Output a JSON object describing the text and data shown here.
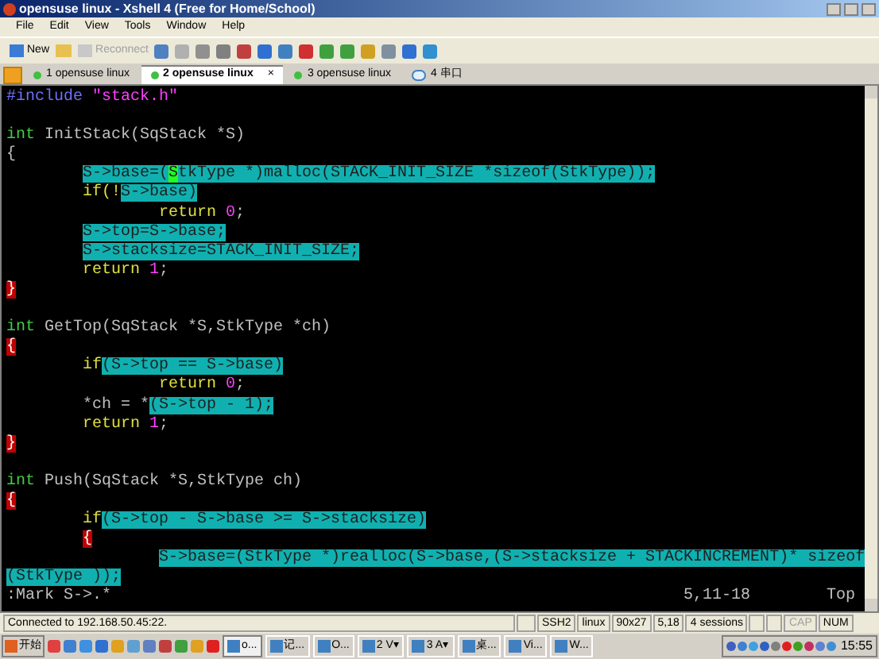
{
  "window": {
    "title": "opensuse linux - Xshell 4 (Free for Home/School)"
  },
  "menu": [
    "File",
    "Edit",
    "View",
    "Tools",
    "Window",
    "Help"
  ],
  "toolbar": [
    {
      "label": "New",
      "disabled": false
    },
    {
      "label": "Reconnect",
      "disabled": true
    }
  ],
  "tabs": [
    {
      "label": "1 opensuse linux",
      "selected": false,
      "kind": "session"
    },
    {
      "label": "2 opensuse linux",
      "selected": true,
      "kind": "session",
      "close": "×"
    },
    {
      "label": "3 opensuse linux",
      "selected": false,
      "kind": "session"
    },
    {
      "label": "4 串口",
      "selected": false,
      "kind": "serial"
    }
  ],
  "terminal": {
    "lines": [
      {
        "kind": "code",
        "segments": [
          {
            "text": "#include ",
            "kind": "preproc"
          },
          {
            "text": "\"stack.h\"",
            "kind": "string"
          }
        ]
      },
      {
        "kind": "blank"
      },
      {
        "kind": "code",
        "segments": [
          {
            "text": "int",
            "kind": "type"
          },
          {
            "text": " InitStack(SqStack *S)",
            "kind": "plain"
          }
        ]
      },
      {
        "kind": "code",
        "segments": [
          {
            "text": "{",
            "kind": "plain"
          }
        ]
      },
      {
        "kind": "code",
        "segments": [
          {
            "kind": "tab"
          },
          {
            "text": "S->base=(",
            "kind": "highlight"
          },
          {
            "text": "S",
            "kind": "cursor"
          },
          {
            "text": "tkType *)malloc(STACK_INIT_SIZE *sizeof(StkType));",
            "kind": "highlight"
          }
        ]
      },
      {
        "kind": "code",
        "segments": [
          {
            "kind": "tab"
          },
          {
            "text": "if(!",
            "kind": "keyword"
          },
          {
            "text": "S->base)",
            "kind": "highlight"
          }
        ]
      },
      {
        "kind": "code",
        "segments": [
          {
            "kind": "tab"
          },
          {
            "kind": "tab"
          },
          {
            "text": "return",
            "kind": "keyword"
          },
          {
            "text": " 0",
            "kind": "number"
          },
          {
            "text": ";",
            "kind": "plain"
          }
        ]
      },
      {
        "kind": "code",
        "segments": [
          {
            "kind": "tab"
          },
          {
            "text": "S->top=S->base;",
            "kind": "highlight"
          }
        ]
      },
      {
        "kind": "code",
        "segments": [
          {
            "kind": "tab"
          },
          {
            "text": "S->stacksize=STACK_INIT_SIZE;",
            "kind": "highlight"
          }
        ]
      },
      {
        "kind": "code",
        "segments": [
          {
            "kind": "tab"
          },
          {
            "text": "return",
            "kind": "keyword"
          },
          {
            "text": " 1",
            "kind": "number"
          },
          {
            "text": ";",
            "kind": "plain"
          }
        ]
      },
      {
        "kind": "code",
        "segments": [
          {
            "text": "}",
            "kind": "bracket"
          }
        ]
      },
      {
        "kind": "blank"
      },
      {
        "kind": "code",
        "segments": [
          {
            "text": "int",
            "kind": "type"
          },
          {
            "text": " GetTop(SqStack *S,StkType *ch)",
            "kind": "plain"
          }
        ]
      },
      {
        "kind": "code",
        "segments": [
          {
            "text": "{",
            "kind": "bracket"
          }
        ]
      },
      {
        "kind": "code",
        "segments": [
          {
            "kind": "tab"
          },
          {
            "text": "if",
            "kind": "keyword"
          },
          {
            "text": "(S->top == S->base)",
            "kind": "highlight"
          }
        ]
      },
      {
        "kind": "code",
        "segments": [
          {
            "kind": "tab"
          },
          {
            "kind": "tab"
          },
          {
            "text": "return",
            "kind": "keyword"
          },
          {
            "text": " 0",
            "kind": "number"
          },
          {
            "text": ";",
            "kind": "plain"
          }
        ]
      },
      {
        "kind": "code",
        "segments": [
          {
            "kind": "tab"
          },
          {
            "text": "*ch = *",
            "kind": "plain"
          },
          {
            "text": "(S->top - 1);",
            "kind": "highlight"
          }
        ]
      },
      {
        "kind": "code",
        "segments": [
          {
            "kind": "tab"
          },
          {
            "text": "return",
            "kind": "keyword"
          },
          {
            "text": " 1",
            "kind": "number"
          },
          {
            "text": ";",
            "kind": "plain"
          }
        ]
      },
      {
        "kind": "code",
        "segments": [
          {
            "text": "}",
            "kind": "bracket"
          }
        ]
      },
      {
        "kind": "blank"
      },
      {
        "kind": "code",
        "segments": [
          {
            "text": "int",
            "kind": "type"
          },
          {
            "text": " Push(SqStack *S,StkType ch)",
            "kind": "plain"
          }
        ]
      },
      {
        "kind": "code",
        "segments": [
          {
            "text": "{",
            "kind": "bracket"
          }
        ]
      },
      {
        "kind": "code",
        "segments": [
          {
            "kind": "tab"
          },
          {
            "text": "if",
            "kind": "keyword"
          },
          {
            "text": "(S->top - S->base >= S->stacksize)",
            "kind": "highlight"
          }
        ]
      },
      {
        "kind": "code",
        "segments": [
          {
            "kind": "tab"
          },
          {
            "text": "{",
            "kind": "bracket"
          }
        ]
      },
      {
        "kind": "code",
        "segments": [
          {
            "kind": "tab"
          },
          {
            "kind": "tab"
          },
          {
            "text": "S->base=(StkType *)realloc(S->base,(S->stacksize + STACKINCREMENT)* sizeof",
            "kind": "highlight"
          }
        ]
      },
      {
        "kind": "code",
        "segments": [
          {
            "text": "(StkType ));",
            "kind": "highlight"
          }
        ]
      }
    ],
    "command": ":Mark S->.*",
    "position": "5,11-18",
    "scroll": "Top"
  },
  "status_bar": {
    "message": "Connected to 192.168.50.45:22.",
    "fields": [
      {
        "text": "SSH2",
        "disabled": false
      },
      {
        "text": "linux",
        "disabled": false
      },
      {
        "text": "90x27",
        "disabled": false
      },
      {
        "text": "5,18",
        "disabled": false
      },
      {
        "text": "4 sessions",
        "disabled": false
      },
      {
        "text": "CAP",
        "disabled": true
      },
      {
        "text": "NUM",
        "disabled": false
      }
    ]
  },
  "taskbar": {
    "start": "开始",
    "items": [
      {
        "label": "o...",
        "selected": true
      },
      {
        "label": "记...",
        "selected": false
      },
      {
        "label": "O...",
        "selected": false
      },
      {
        "label": "2 V▾",
        "selected": false
      },
      {
        "label": "3 A▾",
        "selected": false
      },
      {
        "label": "桌...",
        "selected": false
      },
      {
        "label": "Vi...",
        "selected": false
      },
      {
        "label": "W...",
        "selected": false
      }
    ],
    "clock": "15:55"
  }
}
